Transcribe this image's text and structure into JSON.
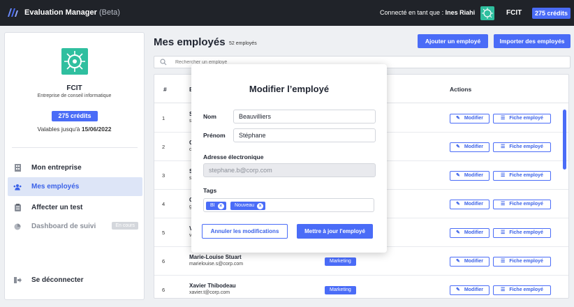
{
  "app": {
    "title": "Evaluation Manager",
    "beta": "(Beta)",
    "connected_prefix": "Connecté en tant que : ",
    "user": "Ines Riahi",
    "company": "FCIT",
    "credits": "275 crédits"
  },
  "sidebar": {
    "company": "FCIT",
    "description": "Entreprise de conseil informatique",
    "credits": "275 crédits",
    "valid_prefix": "Valables jusqu'à ",
    "valid_date": "15/06/2022",
    "items": [
      {
        "label": "Mon entreprise",
        "icon": "building-icon"
      },
      {
        "label": "Mes employés",
        "icon": "users-icon"
      },
      {
        "label": "Affecter un test",
        "icon": "clipboard-icon"
      },
      {
        "label": "Dashboard de suivi",
        "icon": "chart-icon",
        "badge": "En cours"
      }
    ],
    "logout": "Se déconnecter"
  },
  "main": {
    "title": "Mes employés",
    "count": "52 employés",
    "add_button": "Ajouter un employé",
    "import_button": "Importer des employés",
    "search_placeholder": "Rechercher un employé",
    "columns": [
      "#",
      "E",
      "Actions"
    ],
    "modify_label": "Modifier",
    "sheet_label": "Fiche employé",
    "rows": [
      {
        "num": "1",
        "name": "S",
        "email": "s",
        "tag": ""
      },
      {
        "num": "2",
        "name": "C",
        "email": "c",
        "tag": ""
      },
      {
        "num": "3",
        "name": "S",
        "email": "s",
        "tag": ""
      },
      {
        "num": "4",
        "name": "C",
        "email": "g",
        "tag": ""
      },
      {
        "num": "5",
        "name": "V",
        "email": "v",
        "tag": ""
      },
      {
        "num": "6",
        "name": "Marie-Louise Stuart",
        "email": "marielouise.s@corp.com",
        "tag": "Marketing"
      },
      {
        "num": "6",
        "name": "Xavier Thibodeau",
        "email": "xavier.t@corp.com",
        "tag": "Marketing"
      }
    ]
  },
  "modal": {
    "title": "Modifier l’employé",
    "nom_label": "Nom",
    "nom_value": "Beauvilliers",
    "prenom_label": "Prénom",
    "prenom_value": "Stéphane",
    "email_label": "Adresse électronique",
    "email_value": "stephane.b@corp.com",
    "tags_label": "Tags",
    "tags": [
      "BI",
      "Nouveau"
    ],
    "cancel": "Annuler les modifications",
    "save": "Mettre à jour l'employé"
  },
  "colors": {
    "accent": "#4a6cf7",
    "topbar": "#202329",
    "logo": "#2fbf9f"
  }
}
